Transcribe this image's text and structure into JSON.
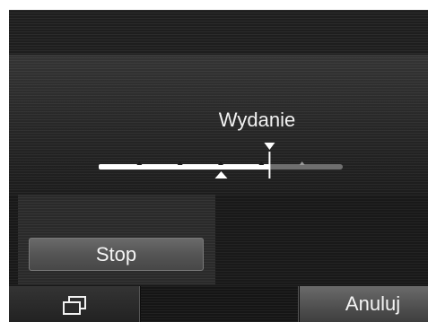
{
  "setting": {
    "label": "Wydanie",
    "level": 0.7,
    "positions": 6
  },
  "buttons": {
    "stop": "Stop",
    "cancel": "Anuluj"
  },
  "icons": {
    "display": "display-mode-icon"
  },
  "colors": {
    "track_filled": "#ffffff",
    "track_empty": "#6f6f6f",
    "background": "#1a1a1a"
  }
}
